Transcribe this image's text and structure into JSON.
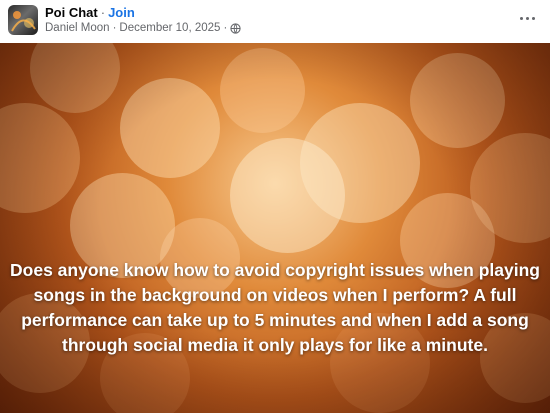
{
  "post": {
    "group_name": "Poi Chat",
    "separator": "·",
    "join_label": "Join",
    "author": "Daniel Moon",
    "date": "December 10, 2025",
    "audience_icon": "globe-icon",
    "more_icon": "more-options-icon"
  },
  "media": {
    "caption": "Does anyone know how to avoid copyright issues when playing songs in the background on videos when I perform? A full performance can take up to 5 minutes and when I add a song through social media it only plays for like a minute."
  },
  "colors": {
    "join_link": "#1b74e4",
    "meta_text": "#65676b",
    "title_text": "#050505"
  }
}
